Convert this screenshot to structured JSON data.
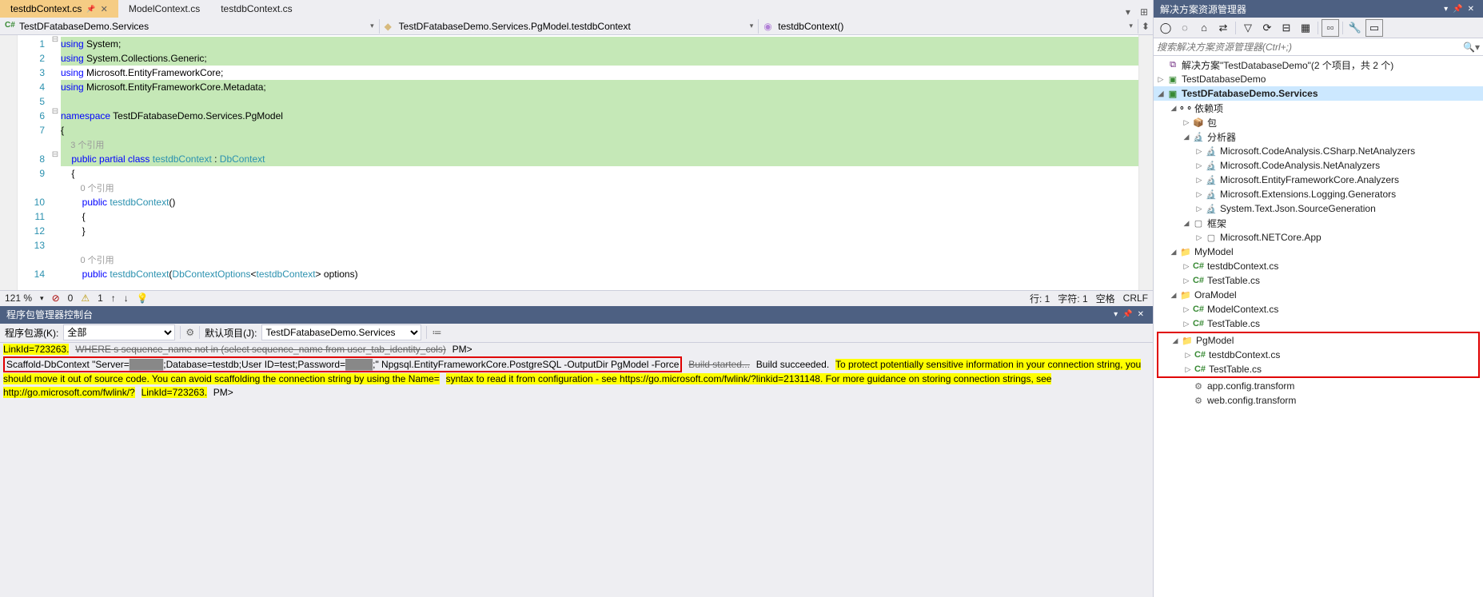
{
  "tabs": [
    {
      "label": "testdbContext.cs",
      "active": true,
      "pinned": true
    },
    {
      "label": "ModelContext.cs",
      "active": false
    },
    {
      "label": "testdbContext.cs",
      "active": false
    }
  ],
  "nav": {
    "left": "TestDFatabaseDemo.Services",
    "mid": "TestDFatabaseDemo.Services.PgModel.testdbContext",
    "right": "testdbContext()"
  },
  "code": {
    "lines": [
      {
        "n": 1,
        "t": [
          {
            "k": "kw",
            "s": "using"
          },
          {
            "s": " System;"
          }
        ],
        "hl": true,
        "fold": "-"
      },
      {
        "n": 2,
        "t": [
          {
            "k": "kw",
            "s": "using"
          },
          {
            "s": " System.Collections.Generic;"
          }
        ],
        "hl": true
      },
      {
        "n": 3,
        "t": [
          {
            "k": "kw",
            "s": "using"
          },
          {
            "s": " Microsoft.EntityFrameworkCore;"
          }
        ],
        "hl": false
      },
      {
        "n": 4,
        "t": [
          {
            "k": "kw",
            "s": "using"
          },
          {
            "s": " Microsoft.EntityFrameworkCore.Metadata;"
          }
        ],
        "hl": true
      },
      {
        "n": 5,
        "t": [],
        "hl": true
      },
      {
        "n": 6,
        "t": [
          {
            "k": "kw",
            "s": "namespace"
          },
          {
            "s": " TestDFatabaseDemo.Services.PgModel"
          }
        ],
        "hl": true,
        "fold": "-"
      },
      {
        "n": 7,
        "t": [
          {
            "s": "{"
          }
        ],
        "hl": true
      },
      {
        "n": "",
        "t": [
          {
            "k": "ref",
            "s": "    3 个引用"
          }
        ],
        "hl": true
      },
      {
        "n": 8,
        "t": [
          {
            "s": "    "
          },
          {
            "k": "kw",
            "s": "public partial class"
          },
          {
            "s": " "
          },
          {
            "k": "type",
            "s": "testdbContext"
          },
          {
            "s": " : "
          },
          {
            "k": "type",
            "s": "DbContext"
          }
        ],
        "hl": true,
        "fold": "-"
      },
      {
        "n": 9,
        "t": [
          {
            "s": "    {"
          }
        ],
        "hl": false
      },
      {
        "n": "",
        "t": [
          {
            "k": "ref",
            "s": "        0 个引用"
          }
        ],
        "hl": false
      },
      {
        "n": 10,
        "t": [
          {
            "s": "        "
          },
          {
            "k": "kw",
            "s": "public"
          },
          {
            "s": " "
          },
          {
            "k": "type",
            "s": "testdbContext"
          },
          {
            "s": "()"
          }
        ],
        "hl": false
      },
      {
        "n": 11,
        "t": [
          {
            "s": "        {"
          }
        ],
        "hl": false
      },
      {
        "n": 12,
        "t": [
          {
            "s": "        }"
          }
        ],
        "hl": false
      },
      {
        "n": 13,
        "t": [],
        "hl": false
      },
      {
        "n": "",
        "t": [
          {
            "k": "ref",
            "s": "        0 个引用"
          }
        ],
        "hl": false
      },
      {
        "n": 14,
        "t": [
          {
            "s": "        "
          },
          {
            "k": "kw",
            "s": "public"
          },
          {
            "s": " "
          },
          {
            "k": "type",
            "s": "testdbContext"
          },
          {
            "s": "("
          },
          {
            "k": "type",
            "s": "DbContextOptions"
          },
          {
            "s": "<"
          },
          {
            "k": "type",
            "s": "testdbContext"
          },
          {
            "s": "> options)"
          }
        ],
        "hl": false
      }
    ]
  },
  "editor_status": {
    "zoom": "121 %",
    "errors": "0",
    "warnings": "1",
    "line": "行: 1",
    "col": "字符: 1",
    "spaces": "空格",
    "crlf": "CRLF"
  },
  "console": {
    "title": "程序包管理器控制台",
    "source_label": "程序包源(K):",
    "source_value": "全部",
    "proj_label": "默认项目(J):",
    "proj_value": "TestDFatabaseDemo.Services",
    "lines": {
      "linkid": "LinkId=723263.",
      "where": "WHERE s sequence_name not in (select sequence_name from user_tab_identity_cols)",
      "pm1": "PM>",
      "cmd": " Scaffold-DbContext \"Server=",
      "cmd2": ";Database=testdb;User ID=test;Password=",
      "cmd3": ";\" Npgsql.EntityFrameworkCore.PostgreSQL -OutputDir PgModel -Force",
      "build_started": "Build started...",
      "build_succ": "Build succeeded.",
      "warn1": "To protect potentially sensitive information in your connection string, you should move it out of source code. You can avoid scaffolding the connection string by using the Name=",
      "warn2": "syntax to read it from configuration - see https://go.microsoft.com/fwlink/?linkid=2131148. For more guidance on storing connection strings, see http://go.microsoft.com/fwlink/?",
      "warn3": "LinkId=723263.",
      "pm2": "PM>"
    }
  },
  "se": {
    "title": "解决方案资源管理器",
    "search_placeholder": "搜索解决方案资源管理器(Ctrl+;)",
    "sln": "解决方案\"TestDatabaseDemo\"(2 个项目，共 2 个)",
    "proj1": "TestDatabaseDemo",
    "proj2": "TestDFatabaseDemo.Services",
    "deps": "依赖项",
    "pkg": "包",
    "analyzer": "分析器",
    "a1": "Microsoft.CodeAnalysis.CSharp.NetAnalyzers",
    "a2": "Microsoft.CodeAnalysis.NetAnalyzers",
    "a3": "Microsoft.EntityFrameworkCore.Analyzers",
    "a4": "Microsoft.Extensions.Logging.Generators",
    "a5": "System.Text.Json.SourceGeneration",
    "framework": "框架",
    "netcore": "Microsoft.NETCore.App",
    "mymodel": "MyModel",
    "m1": "testdbContext.cs",
    "m2": "TestTable.cs",
    "oramodel": "OraModel",
    "o1": "ModelContext.cs",
    "o2": "TestTable.cs",
    "pgmodel": "PgModel",
    "p1": "testdbContext.cs",
    "p2": "TestTable.cs",
    "app": "app.config.transform",
    "web": "web.config.transform"
  }
}
